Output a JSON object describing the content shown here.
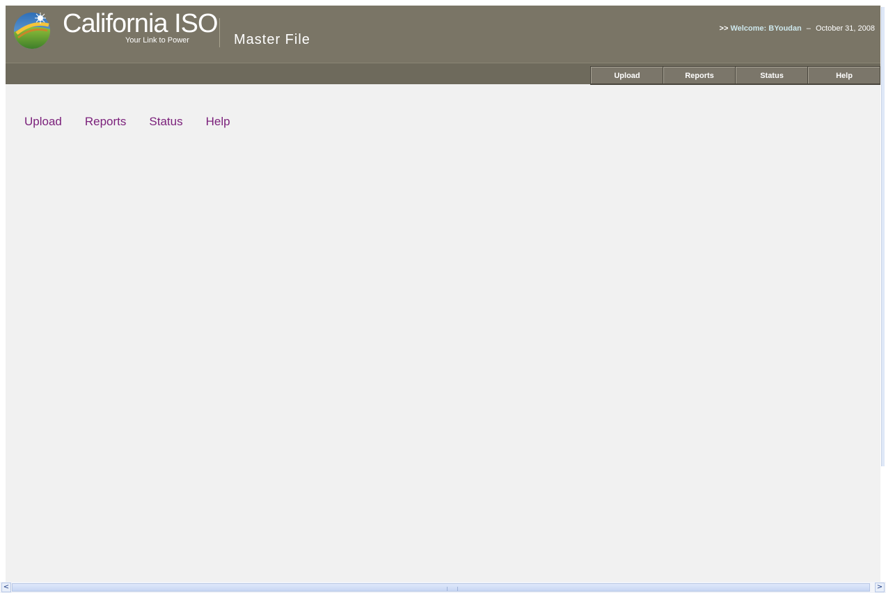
{
  "header": {
    "brand_name": "California ISO",
    "tagline": "Your Link to Power",
    "app_title": "Master File",
    "welcome": {
      "prefix": ">>",
      "label": "Welcome:",
      "user": "BYoudan",
      "separator": "–",
      "date": "October 31, 2008"
    },
    "tabs": [
      {
        "label": "Upload"
      },
      {
        "label": "Reports"
      },
      {
        "label": "Status"
      },
      {
        "label": "Help"
      }
    ]
  },
  "main": {
    "links": [
      {
        "label": "Upload"
      },
      {
        "label": "Reports"
      },
      {
        "label": "Status"
      },
      {
        "label": "Help"
      }
    ]
  },
  "scrollbar": {
    "left_arrow": "<",
    "right_arrow": ">"
  },
  "colors": {
    "header_bg": "#7a7566",
    "link_color": "#7a1f7a",
    "welcome_accent": "#cde7ec",
    "page_bg": "#f1f1f1"
  },
  "icons": {
    "logo": "california-iso-globe-icon"
  }
}
